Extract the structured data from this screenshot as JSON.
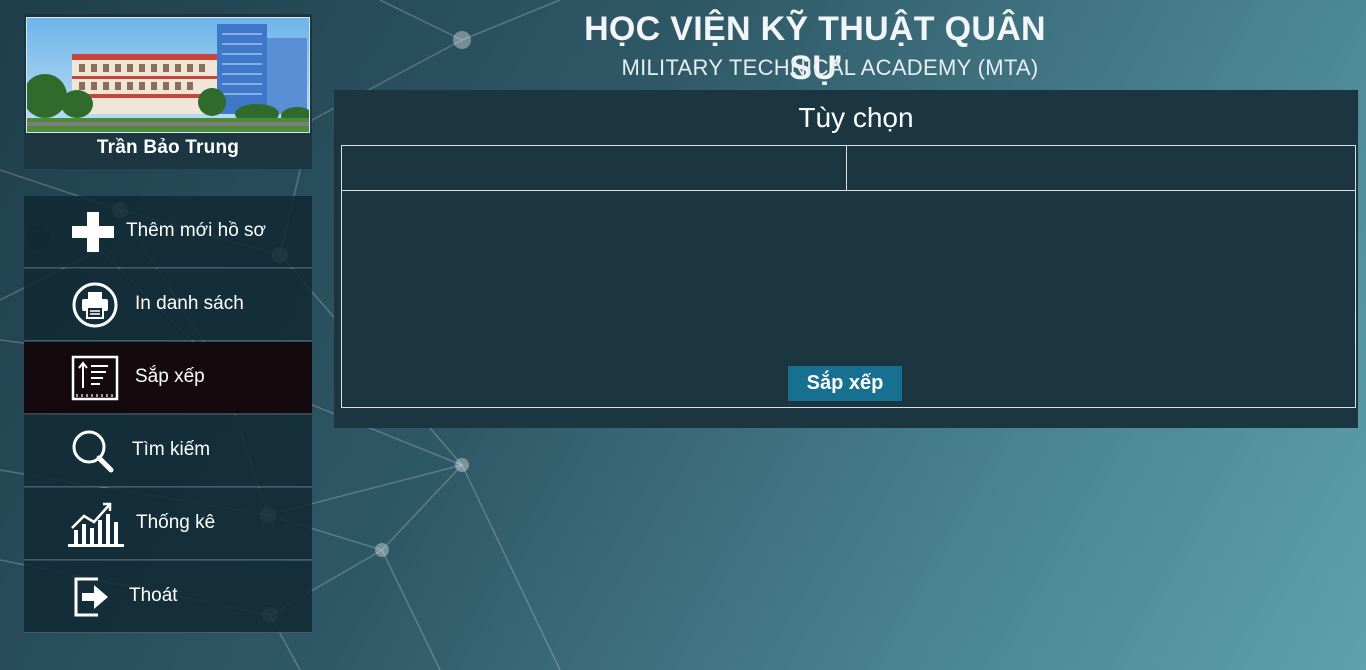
{
  "header": {
    "title": "HỌC VIỆN KỸ THUẬT QUÂN SỰ",
    "subtitle": "MILITARY TECHNICAL ACADEMY (MTA)"
  },
  "profile": {
    "name": "Trần Bảo Trung",
    "photo_icon": "campus-building-photo"
  },
  "menu": {
    "items": [
      {
        "label": "Thêm mới hồ sơ",
        "icon": "plus-icon"
      },
      {
        "label": "In danh sách",
        "icon": "printer-icon"
      },
      {
        "label": "Sắp xếp",
        "icon": "sort-icon",
        "active": true
      },
      {
        "label": "Tìm kiếm",
        "icon": "search-icon"
      },
      {
        "label": "Thống kê",
        "icon": "chart-icon"
      },
      {
        "label": "Thoát",
        "icon": "exit-icon"
      }
    ]
  },
  "panel": {
    "title": "Tùy chọn",
    "left_field_value": "",
    "right_field_value": "",
    "sort_button_label": "Sắp xếp"
  },
  "colors": {
    "panel_bg": "#1b3640",
    "button_bg": "#17708f",
    "active_menu_bg": "#140a0d",
    "menu_bg": "#112a34"
  }
}
